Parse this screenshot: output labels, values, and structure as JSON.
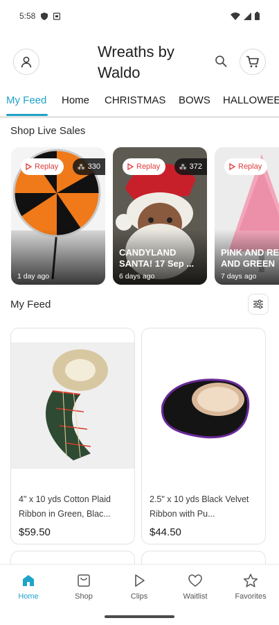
{
  "status_bar": {
    "time": "5:58"
  },
  "header": {
    "title": "Wreaths by Waldo"
  },
  "tabs": [
    {
      "label": "My Feed",
      "active": true
    },
    {
      "label": "Home"
    },
    {
      "label": "CHRISTMAS"
    },
    {
      "label": "BOWS"
    },
    {
      "label": "HALLOWEEN"
    }
  ],
  "live_section": {
    "title": "Shop Live Sales",
    "cards": [
      {
        "replay_label": "Replay",
        "viewers": "330",
        "name": "",
        "time": "1 day ago"
      },
      {
        "replay_label": "Replay",
        "viewers": "372",
        "name": "CANDYLAND SANTA! 17 Sep ...",
        "time": "6 days ago"
      },
      {
        "replay_label": "Replay",
        "viewers": "",
        "name": "PINK AND RED AND GREEN",
        "time": "7 days ago"
      }
    ]
  },
  "feed": {
    "title": "My Feed",
    "products": [
      {
        "name": "4\" x 10 yds Cotton Plaid Ribbon in Green, Blac...",
        "price": "$59.50"
      },
      {
        "name": "2.5\" x 10 yds Black Velvet Ribbon with Pu...",
        "price": "$44.50"
      }
    ]
  },
  "bottom_nav": [
    {
      "label": "Home",
      "icon": "home-icon",
      "active": true
    },
    {
      "label": "Shop",
      "icon": "shop-icon"
    },
    {
      "label": "Clips",
      "icon": "play-icon"
    },
    {
      "label": "Waitlist",
      "icon": "heart-icon"
    },
    {
      "label": "Favorites",
      "icon": "star-icon"
    }
  ],
  "colors": {
    "accent": "#1fa3c8",
    "replay": "#e03a3a"
  }
}
